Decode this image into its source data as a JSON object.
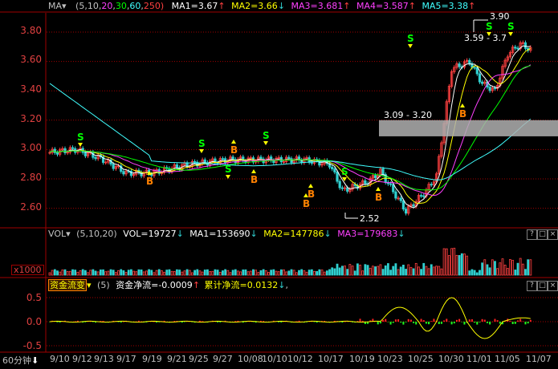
{
  "colors": {
    "up": "#ff4040",
    "down": "#30d0d0",
    "ma5": "#ffffff",
    "ma10": "#ffff00",
    "ma20": "#ff40ff",
    "ma30": "#00ff00",
    "ma60": "#40ffff",
    "ma250": "#ff4040",
    "grid": "#a00000",
    "accent_orange": "#ff8000"
  },
  "price_panel": {
    "indicator_name": "MA",
    "params": "(5,10,",
    "param_20": "20",
    "param_30": "30",
    "param_60": "60",
    "param_250": "250)",
    "ma1": "MA1=3.67",
    "ma2": "MA2=3.66",
    "ma3": "MA3=3.681",
    "ma4": "MA4=3.587",
    "ma5": "MA5=3.38",
    "y_ticks": [
      "3.80",
      "3.60",
      "3.40",
      "3.20",
      "3.00",
      "2.80",
      "2.60"
    ],
    "high_label": "3.90",
    "low_label": "2.52",
    "range_label": "3.09 - 3.20",
    "range_label2": "3.59 - 3.7",
    "signals": [
      {
        "type": "S",
        "label": "S"
      },
      {
        "type": "B",
        "label": "B"
      },
      {
        "type": "S",
        "label": "S"
      },
      {
        "type": "S",
        "label": "S"
      },
      {
        "type": "B",
        "label": "B"
      },
      {
        "type": "B",
        "label": "B"
      },
      {
        "type": "S",
        "label": "S"
      },
      {
        "type": "B",
        "label": "B"
      },
      {
        "type": "B",
        "label": "B"
      },
      {
        "type": "S",
        "label": "S"
      },
      {
        "type": "B",
        "label": "B"
      },
      {
        "type": "S",
        "label": "S"
      },
      {
        "type": "B",
        "label": "B"
      },
      {
        "type": "S",
        "label": "S"
      },
      {
        "type": "S",
        "label": "S"
      }
    ]
  },
  "vol_panel": {
    "indicator_name": "VOL",
    "params": "(5,10,20)",
    "vol": "VOL=19727",
    "ma1": "MA1=153690",
    "ma2": "MA2=147786",
    "ma3": "MA3=179683",
    "unit": "x1000"
  },
  "flow_panel": {
    "indicator_name": "资金流变",
    "params": "(5)",
    "net": "资金净流=-0.0009",
    "cum": "累计净流=0.0132",
    "y_ticks": [
      "0.5",
      "0.0",
      "-0.5"
    ]
  },
  "x_axis": {
    "period": "60分钟",
    "labels": [
      "9/10",
      "9/12",
      "9/13",
      "9/17",
      "9/19",
      "9/21",
      "9/25",
      "9/27",
      "10/08",
      "10/10",
      "10/12",
      "10/17",
      "10/19",
      "10/23",
      "10/25",
      "10/30",
      "11/01",
      "11/05",
      "11/07"
    ]
  },
  "controls": {
    "question": "?",
    "max": "□",
    "close": "×"
  },
  "arrows": {
    "up": "↑",
    "down": "↓"
  }
}
